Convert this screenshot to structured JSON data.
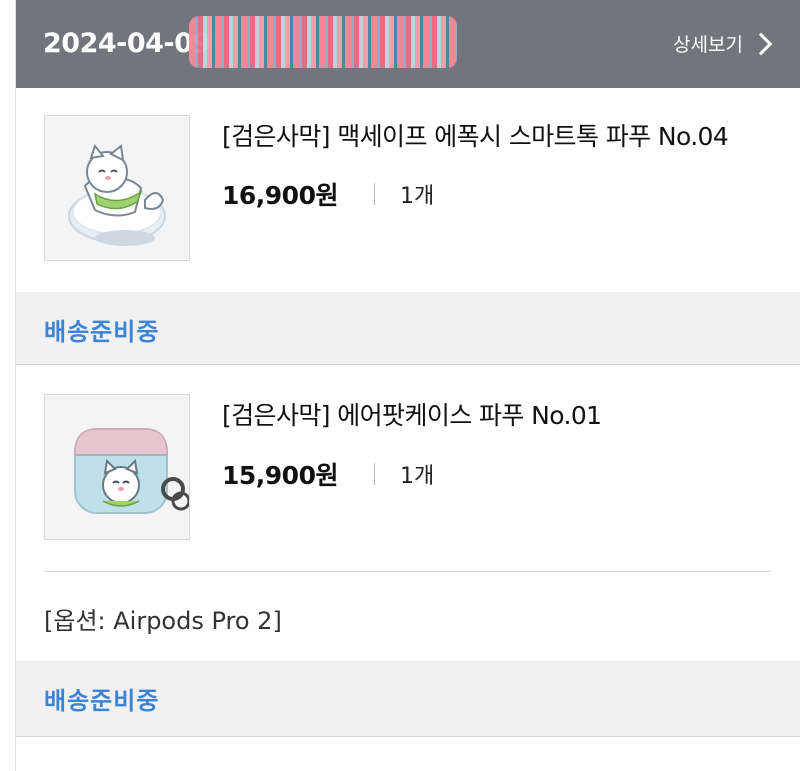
{
  "order": {
    "date": "2024-04-09",
    "detail_label": "상세보기"
  },
  "items": [
    {
      "name": "[검은사막] 맥세이프 에폭시 스마트톡 파푸 No.04",
      "price": "16,900원",
      "qty": "1개",
      "status": "배송준비중",
      "image": "smart-tok-cat-image"
    },
    {
      "name": "[검은사막] 에어팟케이스 파푸 No.01",
      "price": "15,900원",
      "qty": "1개",
      "option": "[옵션: Airpods Pro 2]",
      "status": "배송준비중",
      "image": "airpods-case-cat-image"
    }
  ],
  "colors": {
    "header_bg": "#72757d",
    "status_blue": "#3d83d6",
    "status_bar_bg": "#f1f1f2"
  }
}
